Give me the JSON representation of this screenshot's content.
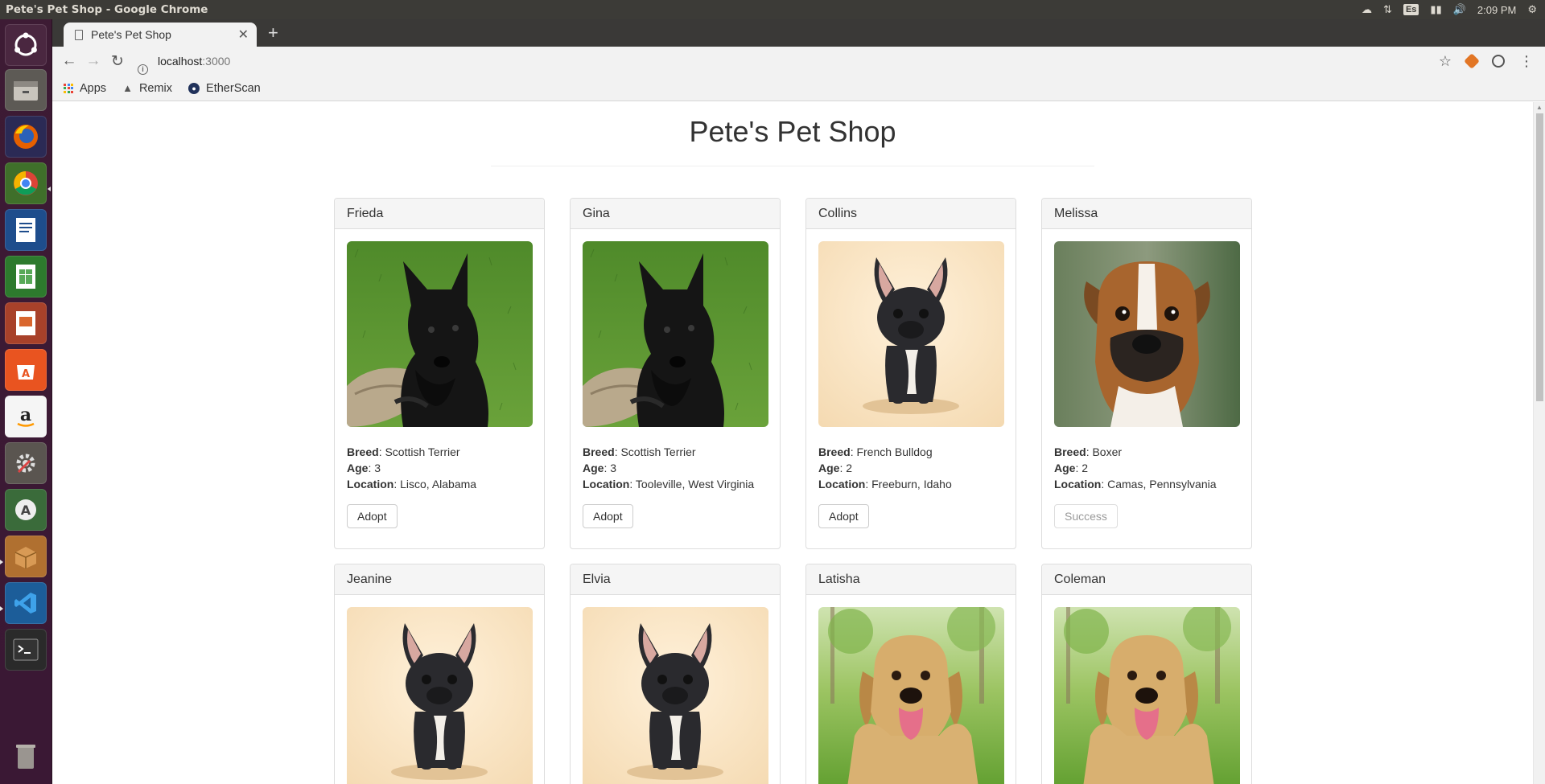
{
  "os": {
    "window_title": "Pete's Pet Shop - Google Chrome",
    "clock": "2:09 PM",
    "keyboard_layout": "Es"
  },
  "browser": {
    "tab_title": "Pete's Pet Shop",
    "url_host": "localhost",
    "url_port": ":3000",
    "bookmarks": [
      {
        "label": "Apps",
        "icon": "apps-grid-icon"
      },
      {
        "label": "Remix",
        "icon": "remix-icon"
      },
      {
        "label": "EtherScan",
        "icon": "etherscan-icon"
      }
    ]
  },
  "page": {
    "title": "Pete's Pet Shop",
    "labels": {
      "breed": "Breed",
      "age": "Age",
      "location": "Location"
    },
    "pets": [
      {
        "name": "Frieda",
        "breed": "Scottish Terrier",
        "age": "3",
        "location": "Lisco, Alabama",
        "button": "Adopt",
        "adopted": false,
        "photo": "scottish-terrier"
      },
      {
        "name": "Gina",
        "breed": "Scottish Terrier",
        "age": "3",
        "location": "Tooleville, West Virginia",
        "button": "Adopt",
        "adopted": false,
        "photo": "scottish-terrier"
      },
      {
        "name": "Collins",
        "breed": "French Bulldog",
        "age": "2",
        "location": "Freeburn, Idaho",
        "button": "Adopt",
        "adopted": false,
        "photo": "french-bulldog"
      },
      {
        "name": "Melissa",
        "breed": "Boxer",
        "age": "2",
        "location": "Camas, Pennsylvania",
        "button": "Success",
        "adopted": true,
        "photo": "boxer"
      },
      {
        "name": "Jeanine",
        "photo": "french-bulldog"
      },
      {
        "name": "Elvia",
        "photo": "french-bulldog"
      },
      {
        "name": "Latisha",
        "photo": "golden-retriever"
      },
      {
        "name": "Coleman",
        "photo": "golden-retriever"
      }
    ]
  }
}
